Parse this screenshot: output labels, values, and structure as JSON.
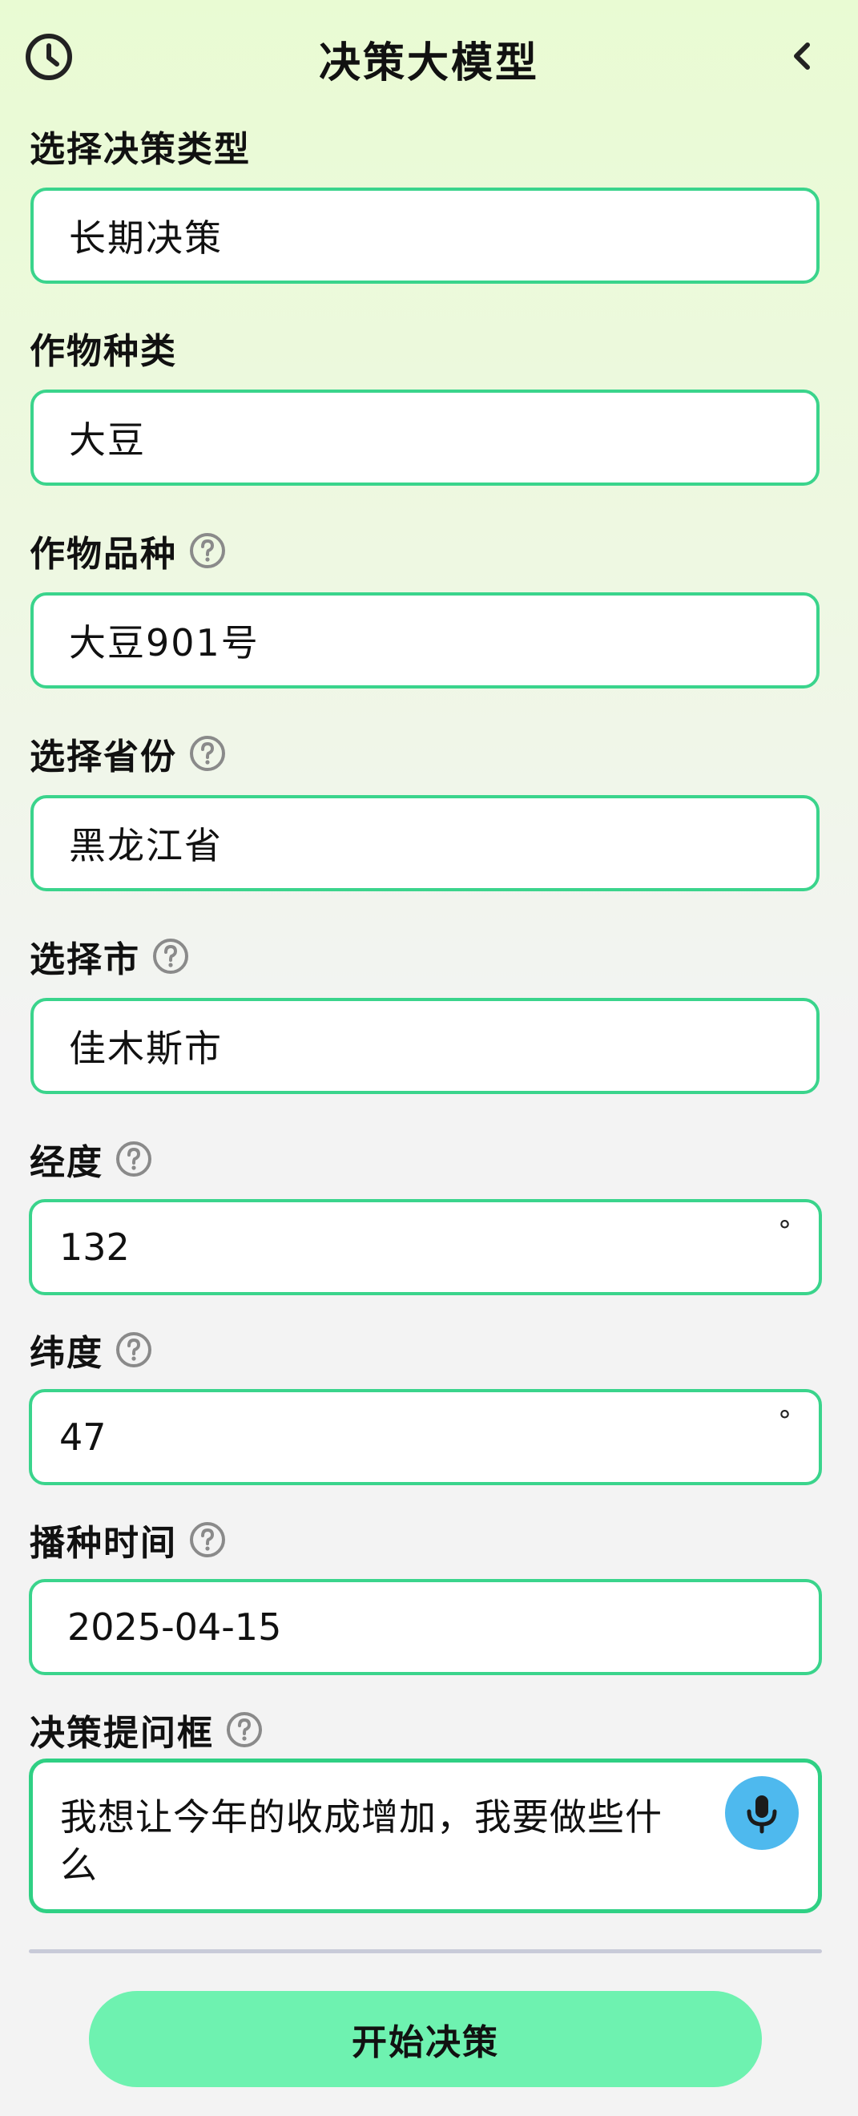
{
  "header": {
    "title": "决策大模型",
    "history_icon": "clock-icon",
    "back_icon": "chevron-left-icon"
  },
  "form": {
    "decision_type": {
      "label": "选择决策类型",
      "value": "长期决策"
    },
    "crop_type": {
      "label": "作物种类",
      "value": "大豆"
    },
    "crop_variety": {
      "label": "作物品种",
      "value": "大豆901号",
      "help_icon": "question-circle-icon"
    },
    "province": {
      "label": "选择省份",
      "value": "黑龙江省",
      "help_icon": "question-circle-icon"
    },
    "city": {
      "label": "选择市",
      "value": "佳木斯市",
      "help_icon": "question-circle-icon"
    },
    "longitude": {
      "label": "经度",
      "value": "132",
      "unit": "°",
      "help_icon": "question-circle-icon"
    },
    "latitude": {
      "label": "纬度",
      "value": "47",
      "unit": "°",
      "help_icon": "question-circle-icon"
    },
    "sowing_time": {
      "label": "播种时间",
      "value": "2025-04-15",
      "help_icon": "question-circle-icon"
    },
    "question": {
      "label": "决策提问框",
      "value": "我想让今年的收成增加，我要做些什么",
      "help_icon": "question-circle-icon",
      "mic_icon": "microphone-icon"
    }
  },
  "actions": {
    "start_label": "开始决策"
  },
  "colors": {
    "accent_border": "#3ad48c",
    "button_bg": "#6ef2b0",
    "mic_bg": "#4eb9ee",
    "header_bg": "#e9fbd3"
  }
}
